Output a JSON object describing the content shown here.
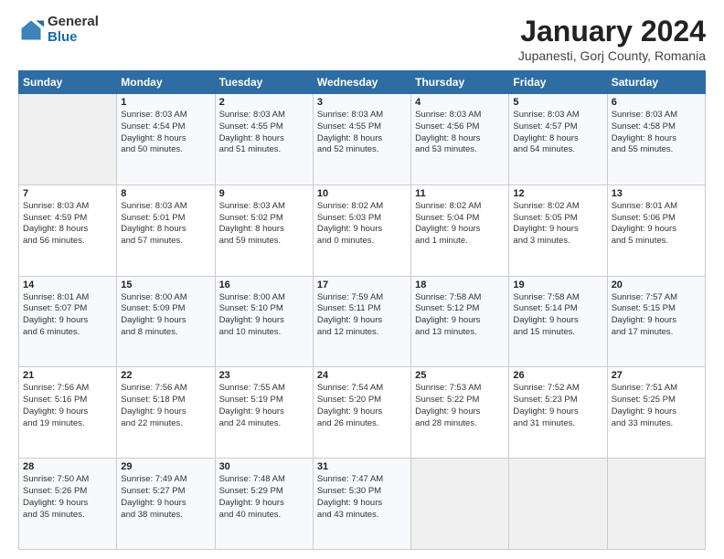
{
  "logo": {
    "general": "General",
    "blue": "Blue"
  },
  "header": {
    "title": "January 2024",
    "subtitle": "Jupanesti, Gorj County, Romania"
  },
  "weekdays": [
    "Sunday",
    "Monday",
    "Tuesday",
    "Wednesday",
    "Thursday",
    "Friday",
    "Saturday"
  ],
  "weeks": [
    [
      {
        "day": "",
        "content": ""
      },
      {
        "day": "1",
        "content": "Sunrise: 8:03 AM\nSunset: 4:54 PM\nDaylight: 8 hours\nand 50 minutes."
      },
      {
        "day": "2",
        "content": "Sunrise: 8:03 AM\nSunset: 4:55 PM\nDaylight: 8 hours\nand 51 minutes."
      },
      {
        "day": "3",
        "content": "Sunrise: 8:03 AM\nSunset: 4:55 PM\nDaylight: 8 hours\nand 52 minutes."
      },
      {
        "day": "4",
        "content": "Sunrise: 8:03 AM\nSunset: 4:56 PM\nDaylight: 8 hours\nand 53 minutes."
      },
      {
        "day": "5",
        "content": "Sunrise: 8:03 AM\nSunset: 4:57 PM\nDaylight: 8 hours\nand 54 minutes."
      },
      {
        "day": "6",
        "content": "Sunrise: 8:03 AM\nSunset: 4:58 PM\nDaylight: 8 hours\nand 55 minutes."
      }
    ],
    [
      {
        "day": "7",
        "content": "Sunrise: 8:03 AM\nSunset: 4:59 PM\nDaylight: 8 hours\nand 56 minutes."
      },
      {
        "day": "8",
        "content": "Sunrise: 8:03 AM\nSunset: 5:01 PM\nDaylight: 8 hours\nand 57 minutes."
      },
      {
        "day": "9",
        "content": "Sunrise: 8:03 AM\nSunset: 5:02 PM\nDaylight: 8 hours\nand 59 minutes."
      },
      {
        "day": "10",
        "content": "Sunrise: 8:02 AM\nSunset: 5:03 PM\nDaylight: 9 hours\nand 0 minutes."
      },
      {
        "day": "11",
        "content": "Sunrise: 8:02 AM\nSunset: 5:04 PM\nDaylight: 9 hours\nand 1 minute."
      },
      {
        "day": "12",
        "content": "Sunrise: 8:02 AM\nSunset: 5:05 PM\nDaylight: 9 hours\nand 3 minutes."
      },
      {
        "day": "13",
        "content": "Sunrise: 8:01 AM\nSunset: 5:06 PM\nDaylight: 9 hours\nand 5 minutes."
      }
    ],
    [
      {
        "day": "14",
        "content": "Sunrise: 8:01 AM\nSunset: 5:07 PM\nDaylight: 9 hours\nand 6 minutes."
      },
      {
        "day": "15",
        "content": "Sunrise: 8:00 AM\nSunset: 5:09 PM\nDaylight: 9 hours\nand 8 minutes."
      },
      {
        "day": "16",
        "content": "Sunrise: 8:00 AM\nSunset: 5:10 PM\nDaylight: 9 hours\nand 10 minutes."
      },
      {
        "day": "17",
        "content": "Sunrise: 7:59 AM\nSunset: 5:11 PM\nDaylight: 9 hours\nand 12 minutes."
      },
      {
        "day": "18",
        "content": "Sunrise: 7:58 AM\nSunset: 5:12 PM\nDaylight: 9 hours\nand 13 minutes."
      },
      {
        "day": "19",
        "content": "Sunrise: 7:58 AM\nSunset: 5:14 PM\nDaylight: 9 hours\nand 15 minutes."
      },
      {
        "day": "20",
        "content": "Sunrise: 7:57 AM\nSunset: 5:15 PM\nDaylight: 9 hours\nand 17 minutes."
      }
    ],
    [
      {
        "day": "21",
        "content": "Sunrise: 7:56 AM\nSunset: 5:16 PM\nDaylight: 9 hours\nand 19 minutes."
      },
      {
        "day": "22",
        "content": "Sunrise: 7:56 AM\nSunset: 5:18 PM\nDaylight: 9 hours\nand 22 minutes."
      },
      {
        "day": "23",
        "content": "Sunrise: 7:55 AM\nSunset: 5:19 PM\nDaylight: 9 hours\nand 24 minutes."
      },
      {
        "day": "24",
        "content": "Sunrise: 7:54 AM\nSunset: 5:20 PM\nDaylight: 9 hours\nand 26 minutes."
      },
      {
        "day": "25",
        "content": "Sunrise: 7:53 AM\nSunset: 5:22 PM\nDaylight: 9 hours\nand 28 minutes."
      },
      {
        "day": "26",
        "content": "Sunrise: 7:52 AM\nSunset: 5:23 PM\nDaylight: 9 hours\nand 31 minutes."
      },
      {
        "day": "27",
        "content": "Sunrise: 7:51 AM\nSunset: 5:25 PM\nDaylight: 9 hours\nand 33 minutes."
      }
    ],
    [
      {
        "day": "28",
        "content": "Sunrise: 7:50 AM\nSunset: 5:26 PM\nDaylight: 9 hours\nand 35 minutes."
      },
      {
        "day": "29",
        "content": "Sunrise: 7:49 AM\nSunset: 5:27 PM\nDaylight: 9 hours\nand 38 minutes."
      },
      {
        "day": "30",
        "content": "Sunrise: 7:48 AM\nSunset: 5:29 PM\nDaylight: 9 hours\nand 40 minutes."
      },
      {
        "day": "31",
        "content": "Sunrise: 7:47 AM\nSunset: 5:30 PM\nDaylight: 9 hours\nand 43 minutes."
      },
      {
        "day": "",
        "content": ""
      },
      {
        "day": "",
        "content": ""
      },
      {
        "day": "",
        "content": ""
      }
    ]
  ]
}
